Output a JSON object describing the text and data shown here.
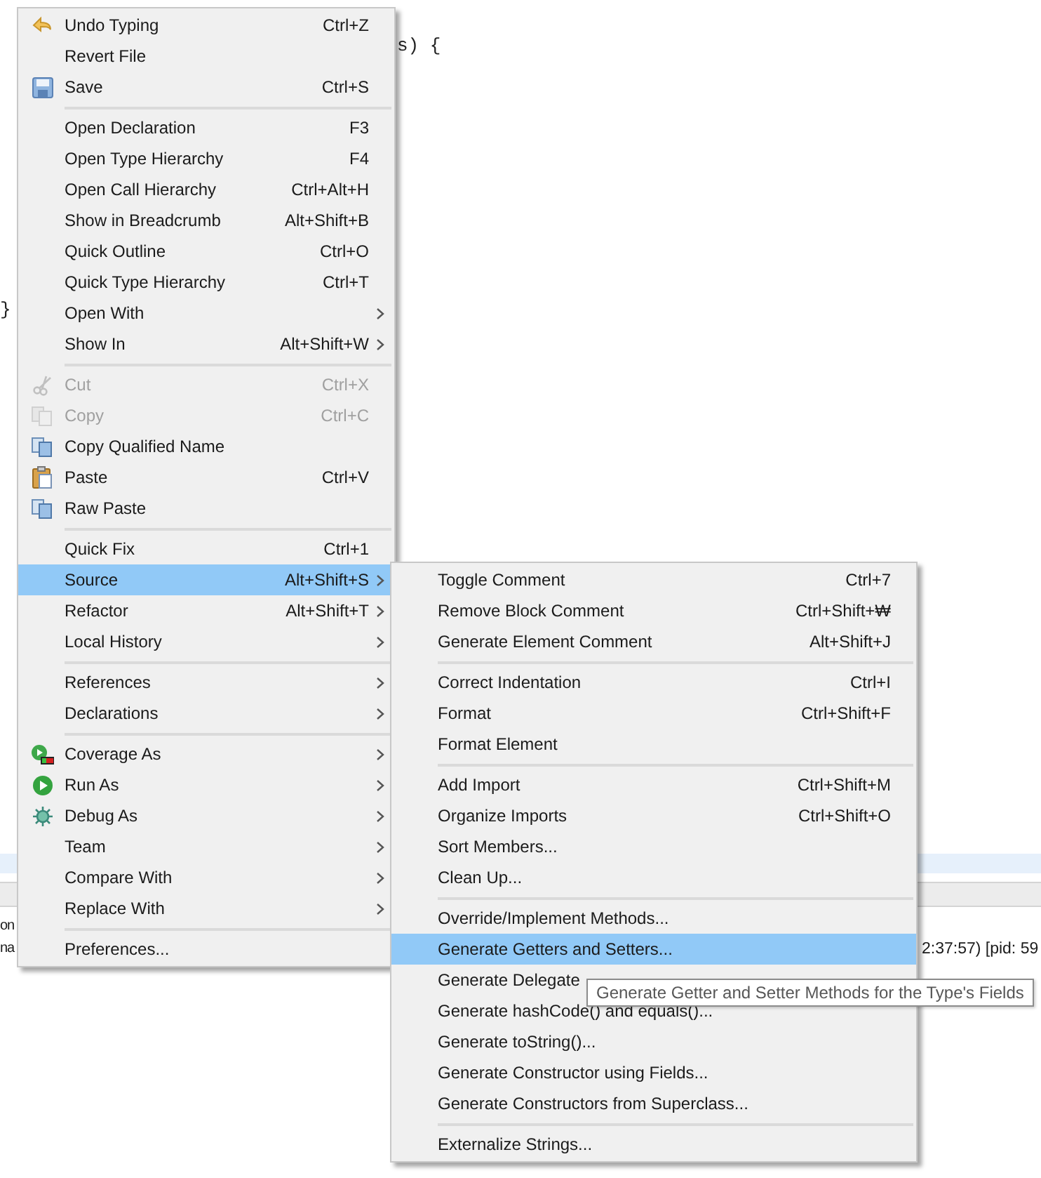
{
  "editor": {
    "code_lines": [
      "s) {",
      "}"
    ]
  },
  "console": {
    "line_1": "on",
    "line_2": "na",
    "process_info": "2:37:57) [pid: 59"
  },
  "context_menu": {
    "items": [
      {
        "kind": "undo",
        "label": "Undo Typing",
        "shortcut": "Ctrl+Z",
        "has_submenu": false,
        "disabled": false,
        "selected": false
      },
      {
        "kind": "plain",
        "label": "Revert File",
        "has_submenu": false,
        "disabled": false,
        "selected": false
      },
      {
        "kind": "save",
        "label": "Save",
        "shortcut": "Ctrl+S",
        "has_submenu": false,
        "disabled": false,
        "selected": false
      },
      {
        "kind": "separator"
      },
      {
        "kind": "plain",
        "label": "Open Declaration",
        "shortcut": "F3",
        "has_submenu": false,
        "disabled": false,
        "selected": false
      },
      {
        "kind": "plain",
        "label": "Open Type Hierarchy",
        "shortcut": "F4",
        "has_submenu": false,
        "disabled": false,
        "selected": false
      },
      {
        "kind": "plain",
        "label": "Open Call Hierarchy",
        "shortcut": "Ctrl+Alt+H",
        "has_submenu": false,
        "disabled": false,
        "selected": false
      },
      {
        "kind": "plain",
        "label": "Show in Breadcrumb",
        "shortcut": "Alt+Shift+B",
        "has_submenu": false,
        "disabled": false,
        "selected": false
      },
      {
        "kind": "plain",
        "label": "Quick Outline",
        "shortcut": "Ctrl+O",
        "has_submenu": false,
        "disabled": false,
        "selected": false
      },
      {
        "kind": "plain",
        "label": "Quick Type Hierarchy",
        "shortcut": "Ctrl+T",
        "has_submenu": false,
        "disabled": false,
        "selected": false
      },
      {
        "kind": "plain",
        "label": "Open With",
        "has_submenu": true,
        "disabled": false,
        "selected": false
      },
      {
        "kind": "plain",
        "label": "Show In",
        "shortcut": "Alt+Shift+W",
        "has_submenu": true,
        "disabled": false,
        "selected": false
      },
      {
        "kind": "separator"
      },
      {
        "kind": "scissors",
        "label": "Cut",
        "shortcut": "Ctrl+X",
        "has_submenu": false,
        "disabled": true,
        "selected": false
      },
      {
        "kind": "pages",
        "label": "Copy",
        "shortcut": "Ctrl+C",
        "has_submenu": false,
        "disabled": true,
        "selected": false
      },
      {
        "kind": "pages",
        "label": "Copy Qualified Name",
        "has_submenu": false,
        "disabled": false,
        "selected": false
      },
      {
        "kind": "clipboard",
        "label": "Paste",
        "shortcut": "Ctrl+V",
        "has_submenu": false,
        "disabled": false,
        "selected": false
      },
      {
        "kind": "pages",
        "label": "Raw Paste",
        "has_submenu": false,
        "disabled": false,
        "selected": false
      },
      {
        "kind": "separator"
      },
      {
        "kind": "plain",
        "label": "Quick Fix",
        "shortcut": "Ctrl+1",
        "has_submenu": false,
        "disabled": false,
        "selected": false
      },
      {
        "kind": "plain",
        "label": "Source",
        "shortcut": "Alt+Shift+S",
        "has_submenu": true,
        "disabled": false,
        "selected": true
      },
      {
        "kind": "plain",
        "label": "Refactor",
        "shortcut": "Alt+Shift+T",
        "has_submenu": true,
        "disabled": false,
        "selected": false
      },
      {
        "kind": "plain",
        "label": "Local History",
        "has_submenu": true,
        "disabled": false,
        "selected": false
      },
      {
        "kind": "separator"
      },
      {
        "kind": "plain",
        "label": "References",
        "has_submenu": true,
        "disabled": false,
        "selected": false
      },
      {
        "kind": "plain",
        "label": "Declarations",
        "has_submenu": true,
        "disabled": false,
        "selected": false
      },
      {
        "kind": "separator"
      },
      {
        "kind": "coverage",
        "label": "Coverage As",
        "has_submenu": true,
        "disabled": false,
        "selected": false
      },
      {
        "kind": "run",
        "label": "Run As",
        "has_submenu": true,
        "disabled": false,
        "selected": false
      },
      {
        "kind": "debug",
        "label": "Debug As",
        "has_submenu": true,
        "disabled": false,
        "selected": false
      },
      {
        "kind": "plain",
        "label": "Team",
        "has_submenu": true,
        "disabled": false,
        "selected": false
      },
      {
        "kind": "plain",
        "label": "Compare With",
        "has_submenu": true,
        "disabled": false,
        "selected": false
      },
      {
        "kind": "plain",
        "label": "Replace With",
        "has_submenu": true,
        "disabled": false,
        "selected": false
      },
      {
        "kind": "separator"
      },
      {
        "kind": "plain",
        "label": "Preferences...",
        "has_submenu": false,
        "disabled": false,
        "selected": false
      }
    ]
  },
  "source_submenu": {
    "items": [
      {
        "kind": "plain",
        "label": "Toggle Comment",
        "shortcut": "Ctrl+7",
        "selected": false
      },
      {
        "kind": "plain",
        "label": "Remove Block Comment",
        "shortcut": "Ctrl+Shift+₩",
        "selected": false
      },
      {
        "kind": "plain",
        "label": "Generate Element Comment",
        "shortcut": "Alt+Shift+J",
        "selected": false
      },
      {
        "kind": "separator"
      },
      {
        "kind": "plain",
        "label": "Correct Indentation",
        "shortcut": "Ctrl+I",
        "selected": false
      },
      {
        "kind": "plain",
        "label": "Format",
        "shortcut": "Ctrl+Shift+F",
        "selected": false
      },
      {
        "kind": "plain",
        "label": "Format Element",
        "selected": false
      },
      {
        "kind": "separator"
      },
      {
        "kind": "plain",
        "label": "Add Import",
        "shortcut": "Ctrl+Shift+M",
        "selected": false
      },
      {
        "kind": "plain",
        "label": "Organize Imports",
        "shortcut": "Ctrl+Shift+O",
        "selected": false
      },
      {
        "kind": "plain",
        "label": "Sort Members...",
        "selected": false
      },
      {
        "kind": "plain",
        "label": "Clean Up...",
        "selected": false
      },
      {
        "kind": "separator"
      },
      {
        "kind": "plain",
        "label": "Override/Implement Methods...",
        "selected": false
      },
      {
        "kind": "plain",
        "label": "Generate Getters and Setters...",
        "selected": true
      },
      {
        "kind": "plain",
        "label": "Generate Delegate",
        "selected": false
      },
      {
        "kind": "plain",
        "label": "Generate hashCode() and equals()...",
        "selected": false
      },
      {
        "kind": "plain",
        "label": "Generate toString()...",
        "selected": false
      },
      {
        "kind": "plain",
        "label": "Generate Constructor using Fields...",
        "selected": false
      },
      {
        "kind": "plain",
        "label": "Generate Constructors from Superclass...",
        "selected": false
      },
      {
        "kind": "separator"
      },
      {
        "kind": "plain",
        "label": "Externalize Strings...",
        "selected": false
      }
    ]
  },
  "tooltip": {
    "text": "Generate Getter and Setter Methods for the Type's Fields"
  }
}
